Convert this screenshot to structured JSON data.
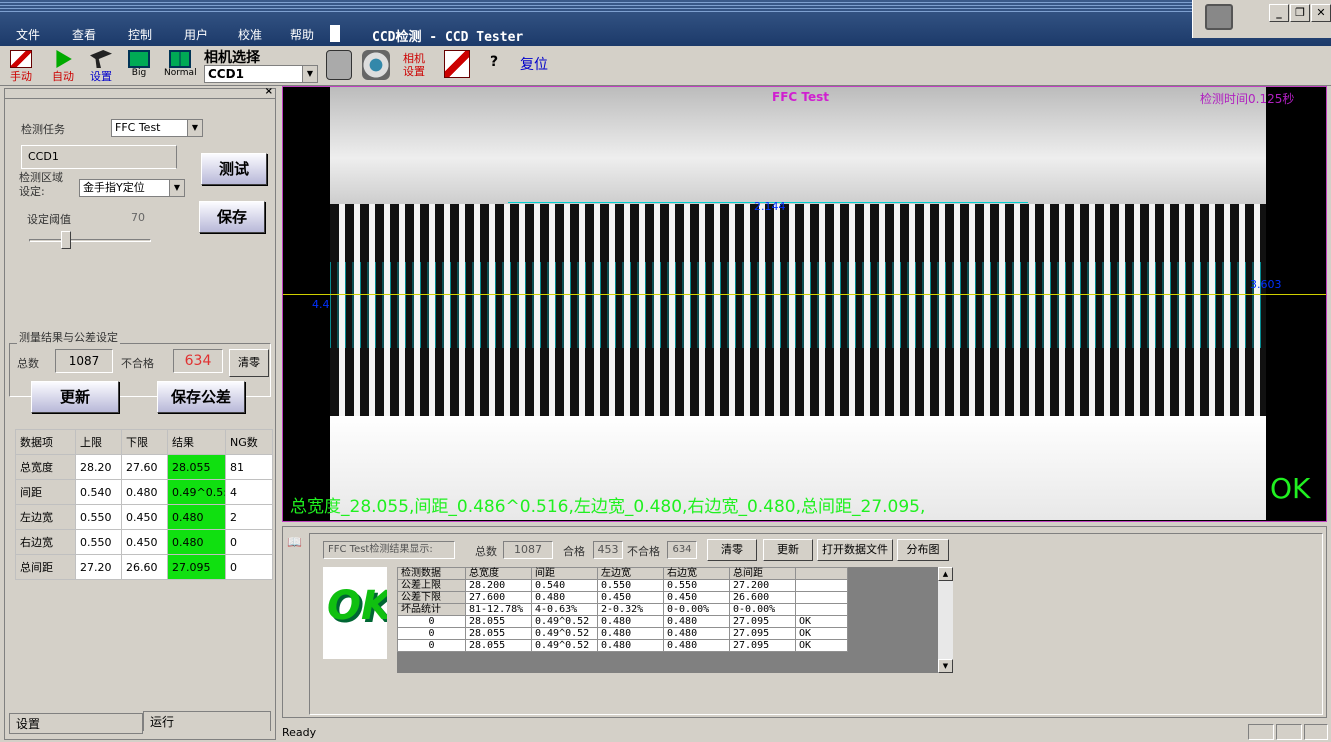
{
  "menu": [
    "文件",
    "查看",
    "控制",
    "用户",
    "校准",
    "帮助"
  ],
  "app_title": "CCD检测 - CCD Tester",
  "toolbar": {
    "manual": "手动",
    "auto": "自动",
    "settings": "设置",
    "big": "Big",
    "normal": "Normal",
    "camera_select_label": "相机选择",
    "camera_value": "CCD1",
    "camera_settings": "相机\n设置",
    "reset": "复位"
  },
  "left": {
    "task_label": "检测任务",
    "task_value": "FFC Test",
    "group_label": "CCD1",
    "region_label": "检测区域\n设定:",
    "region_value": "金手指Y定位",
    "threshold_label": "设定阈值",
    "threshold_value": "70",
    "test_btn": "测试",
    "save_btn": "保存",
    "section_title": "测量结果与公差设定",
    "total_label": "总数",
    "total_value": "1087",
    "ng_label": "不合格",
    "ng_value": "634",
    "clear_btn": "清零",
    "update_btn": "更新",
    "save_tol_btn": "保存公差",
    "table_header": [
      "数据项",
      "上限",
      "下限",
      "结果",
      "NG数"
    ],
    "table_rows": [
      [
        "总宽度",
        "28.20",
        "27.60",
        "28.055",
        "81"
      ],
      [
        "间距",
        "0.540",
        "0.480",
        "0.49^0.5:",
        "4"
      ],
      [
        "左边宽",
        "0.550",
        "0.450",
        "0.480",
        "2"
      ],
      [
        "右边宽",
        "0.550",
        "0.450",
        "0.480",
        "0"
      ],
      [
        "总间距",
        "27.20",
        "26.60",
        "27.095",
        "0"
      ]
    ],
    "tabs": [
      "设置",
      "运行"
    ]
  },
  "viewer": {
    "title": "FFC Test",
    "time": "检测时间0.125秒",
    "top_measure": "2.144",
    "right_measure": "3.603",
    "left_measure": "4.4",
    "result_text": "总宽度_28.055,间距_0.486^0.516,左边宽_0.480,右边宽_0.480,总间距_27.095,",
    "ok": "OK"
  },
  "bottom": {
    "caption": "FFC Test检测结果显示:",
    "total_label": "总数",
    "total_value": "1087",
    "pass_label": "合格",
    "pass_value": "453",
    "ng_label": "不合格",
    "ng_value": "634",
    "buttons": [
      "清零",
      "更新",
      "打开数据文件",
      "分布图"
    ],
    "ok_logo": "OK",
    "res_header": [
      "检测数据",
      "总宽度",
      "间距",
      "左边宽",
      "右边宽",
      "总间距",
      ""
    ],
    "res_rows": [
      [
        "公差上限",
        "28.200",
        "0.540",
        "0.550",
        "0.550",
        "27.200",
        ""
      ],
      [
        "公差下限",
        "27.600",
        "0.480",
        "0.450",
        "0.450",
        "26.600",
        ""
      ],
      [
        "坏品统计",
        "81-12.78%",
        "4-0.63%",
        "2-0.32%",
        "0-0.00%",
        "0-0.00%",
        ""
      ],
      [
        "0",
        "28.055",
        "0.49^0.52",
        "0.480",
        "0.480",
        "27.095",
        "OK"
      ],
      [
        "0",
        "28.055",
        "0.49^0.52",
        "0.480",
        "0.480",
        "27.095",
        "OK"
      ],
      [
        "0",
        "28.055",
        "0.49^0.52",
        "0.480",
        "0.480",
        "27.095",
        "OK"
      ]
    ]
  },
  "status": "Ready"
}
